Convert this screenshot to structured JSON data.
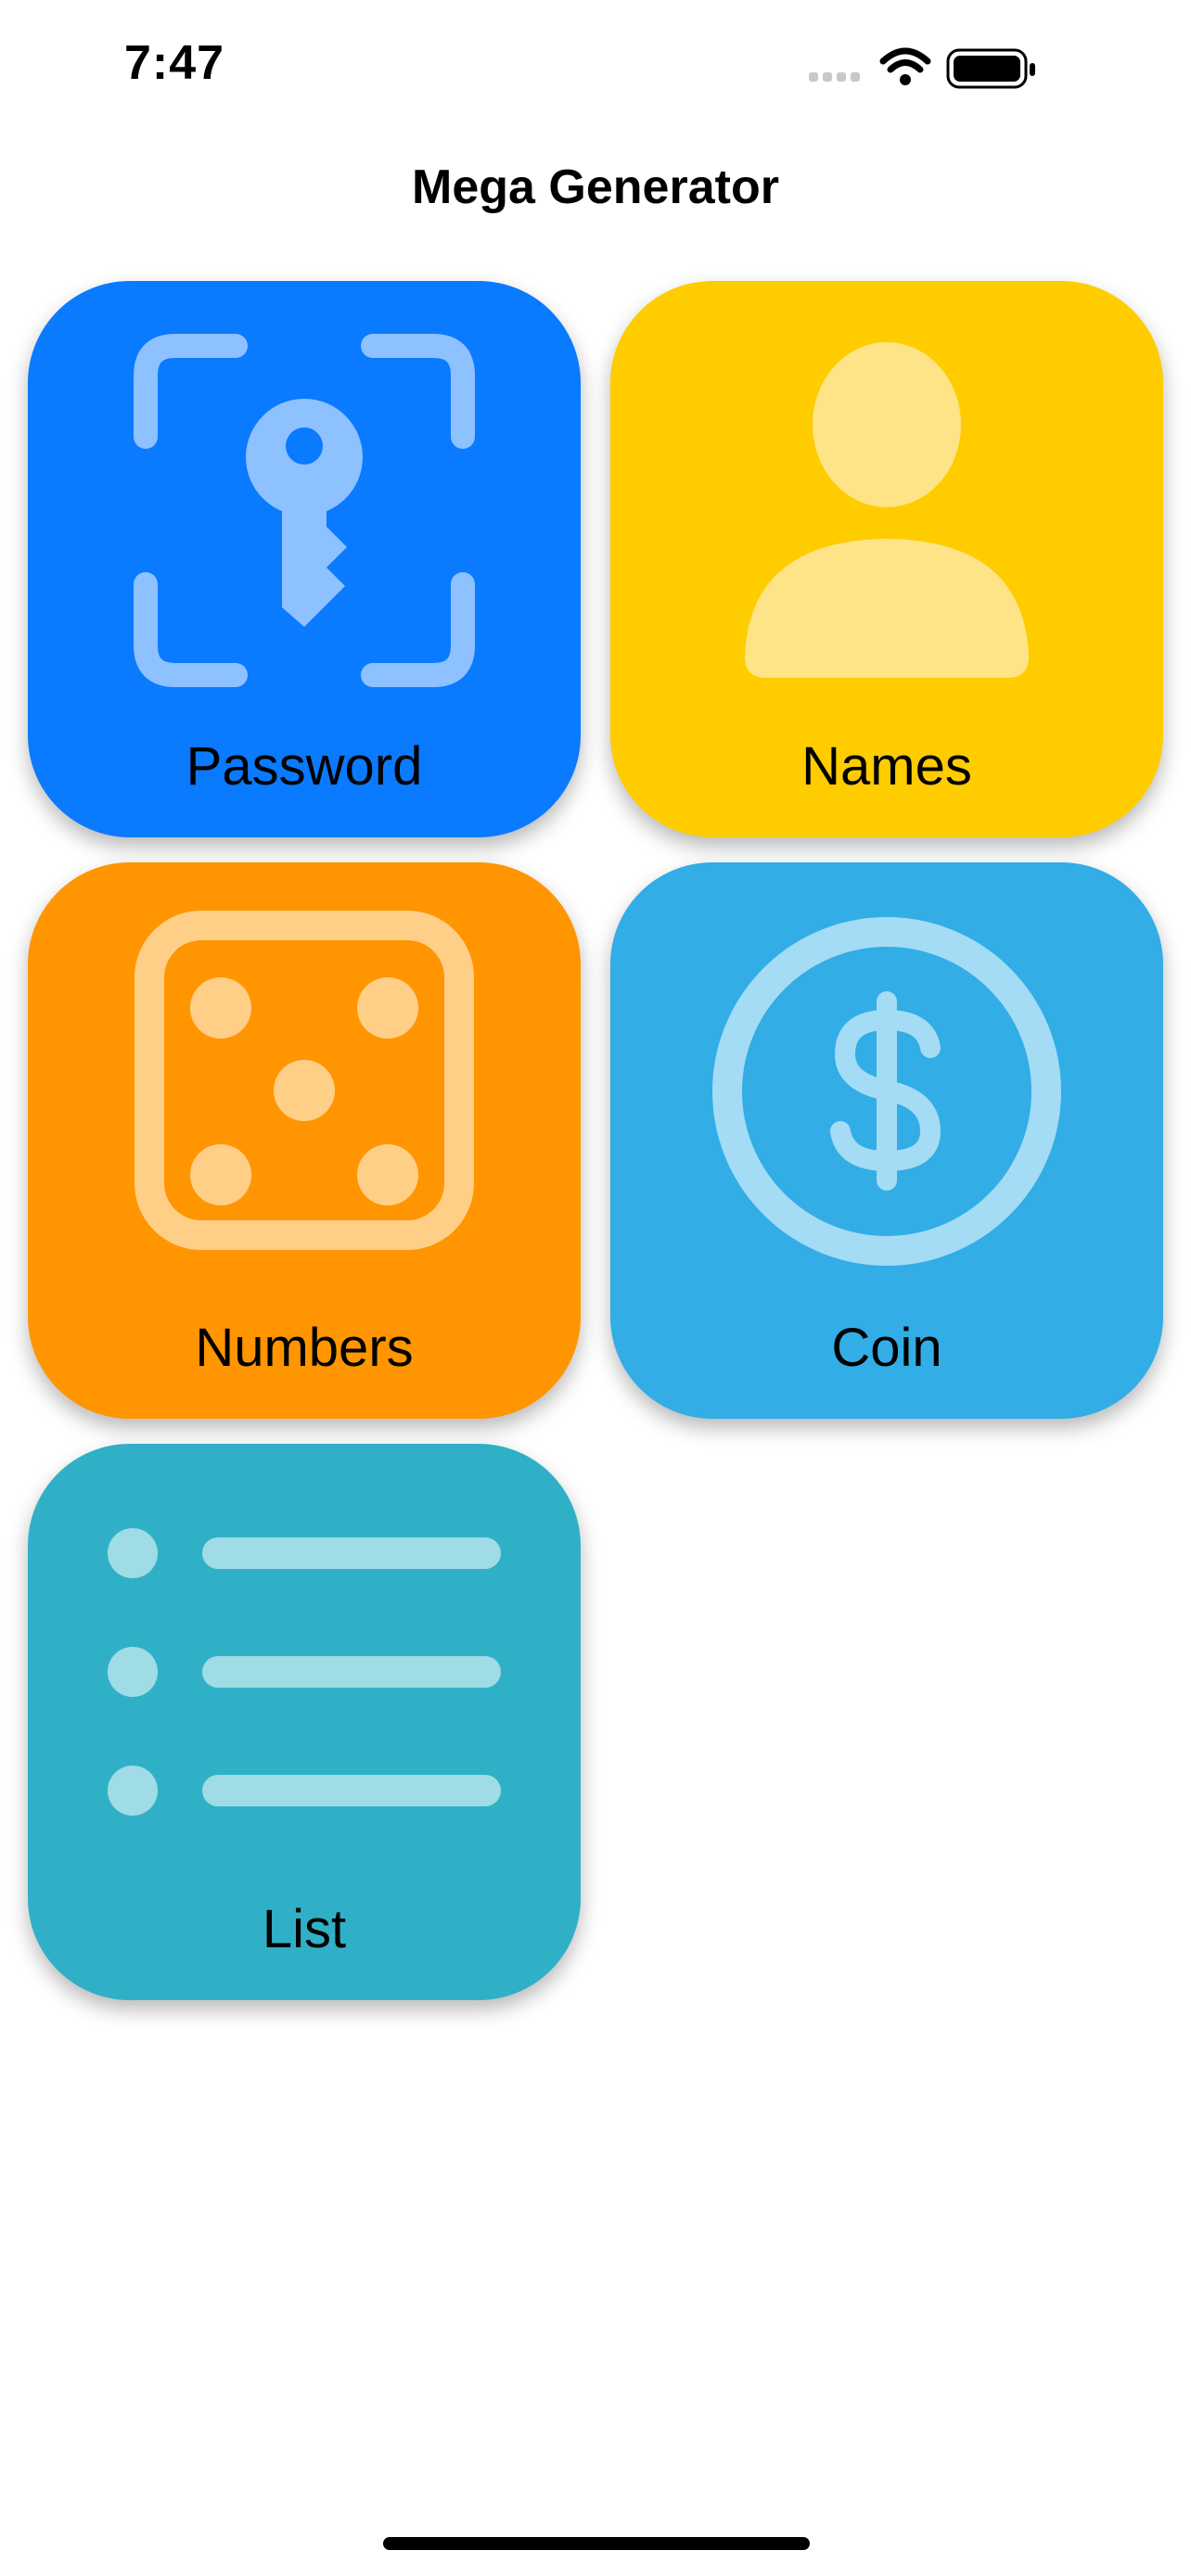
{
  "status_bar": {
    "time": "7:47"
  },
  "nav": {
    "title": "Mega Generator"
  },
  "tiles": [
    {
      "label": "Password",
      "color": "#0A7AFF",
      "icon": "key-viewfinder-icon"
    },
    {
      "label": "Names",
      "color": "#FFCC00",
      "icon": "person-icon"
    },
    {
      "label": "Numbers",
      "color": "#FF9500",
      "icon": "die-face-5-icon"
    },
    {
      "label": "Coin",
      "color": "#32ADE6",
      "icon": "dollar-sign-circle-icon"
    },
    {
      "label": "List",
      "color": "#30B0C7",
      "icon": "bulleted-list-icon"
    }
  ]
}
